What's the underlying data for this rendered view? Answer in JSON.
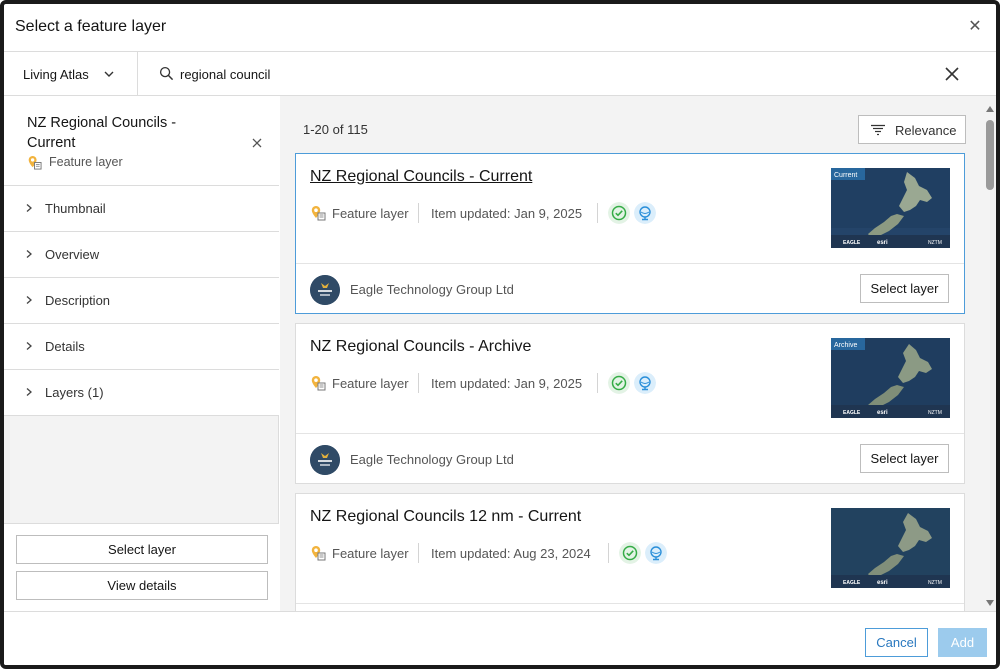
{
  "dialog": {
    "title": "Select a feature layer",
    "close_icon": "close-icon"
  },
  "search": {
    "source_label": "Living Atlas",
    "query": "regional council",
    "search_icon": "search-icon",
    "clear_icon": "close-icon"
  },
  "selected": {
    "title": "NZ Regional Councils - Current",
    "type": "Feature layer",
    "type_icon": "feature-layer-icon",
    "close_icon": "close-icon"
  },
  "sections": [
    {
      "label": "Thumbnail"
    },
    {
      "label": "Overview"
    },
    {
      "label": "Description"
    },
    {
      "label": "Details"
    },
    {
      "label": "Layers (1)"
    }
  ],
  "left_footer": {
    "select_label": "Select layer",
    "view_label": "View details"
  },
  "results": {
    "count": "1-20 of 115",
    "sort_label": "Relevance",
    "items": [
      {
        "title": "NZ Regional Councils - Current",
        "type": "Feature layer",
        "updated": "Item updated: Jan 9, 2025",
        "owner": "Eagle Technology Group Ltd",
        "button": "Select layer",
        "thumb_tag": "Current",
        "thumb_footer": [
          "EAGLE",
          "esri",
          "NZTM"
        ]
      },
      {
        "title": "NZ Regional Councils - Archive",
        "type": "Feature layer",
        "updated": "Item updated: Jan 9, 2025",
        "owner": "Eagle Technology Group Ltd",
        "button": "Select layer",
        "thumb_tag": "Archive",
        "thumb_footer": [
          "EAGLE",
          "esri",
          "NZTM"
        ]
      },
      {
        "title": "NZ Regional Councils 12 nm - Current",
        "type": "Feature layer",
        "updated": "Item updated: Aug 23, 2024",
        "owner": "",
        "button": "",
        "thumb_tag": "",
        "thumb_footer": [
          "EAGLE",
          "esri",
          "NZTM"
        ]
      }
    ]
  },
  "footer": {
    "cancel_label": "Cancel",
    "add_label": "Add"
  },
  "colors": {
    "accent": "#2978bf",
    "accent_light": "#9ccbed",
    "authoritative_badge": "#35ac46",
    "living_atlas_badge": "#2b8fd9"
  }
}
